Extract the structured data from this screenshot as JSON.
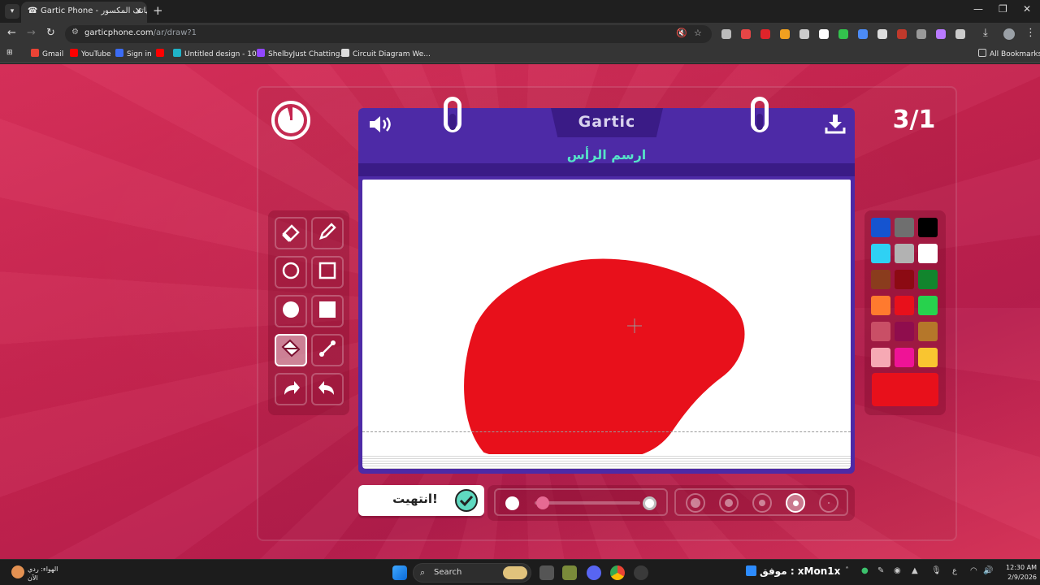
{
  "browser": {
    "tab_title": "Gartic Phone - الهاتف المكسور",
    "tab_favicon": "phone-icon",
    "url_host": "garticphone.com",
    "url_path": "/ar/draw?1",
    "all_bookmarks_label": "All Bookmarks",
    "bookmarks": [
      {
        "label": "Gmail",
        "icon": "gmail-icon",
        "color": "#ea4335"
      },
      {
        "label": "YouTube",
        "icon": "youtube-icon",
        "color": "#ff0000"
      },
      {
        "label": "Sign in",
        "icon": "sign-in-icon",
        "color": "#3b6cf5"
      },
      {
        "label": "",
        "icon": "youtube-icon",
        "color": "#ff0000"
      },
      {
        "label": "Untitled design - 10...",
        "icon": "canva-icon",
        "color": "#1fb3c8"
      },
      {
        "label": "ShelbyJust Chatting...",
        "icon": "twitch-icon",
        "color": "#9147ff"
      },
      {
        "label": "Circuit Diagram We...",
        "icon": "circuit-icon",
        "color": "#dddddd"
      }
    ],
    "extensions": [
      {
        "icon": "ext-square-icon",
        "color": "#bbbbbb"
      },
      {
        "icon": "ext-red-icon",
        "color": "#e64646"
      },
      {
        "icon": "ext-record-icon",
        "color": "#e0242a"
      },
      {
        "icon": "ext-hand-icon",
        "color": "#f0a020"
      },
      {
        "icon": "ext-arrow-icon",
        "color": "#cccccc"
      },
      {
        "icon": "ext-diamond-icon",
        "color": "#ffffff"
      },
      {
        "icon": "ext-battery-icon",
        "color": "#33c24d"
      },
      {
        "icon": "ext-translate-icon",
        "color": "#4c8bf5"
      },
      {
        "icon": "ext-m-icon",
        "color": "#dddddd"
      },
      {
        "icon": "ext-badge-icon",
        "color": "#c0392b"
      },
      {
        "icon": "ext-text-icon",
        "color": "#999999"
      },
      {
        "icon": "ext-music-icon",
        "color": "#b97aff"
      },
      {
        "icon": "puzzle-icon",
        "color": "#cccccc"
      }
    ]
  },
  "game": {
    "round": "3/1",
    "logo": "Gartic",
    "prompt": "ارسم الرأس",
    "done_label": "انتهيت!",
    "colors": {
      "accent_purple": "#4d2aa6",
      "prompt_teal": "#55e3c8",
      "selected_color": "#e8101b"
    },
    "tools": [
      {
        "name": "eraser-tool",
        "icon": "eraser-icon",
        "active": false
      },
      {
        "name": "pencil-tool",
        "icon": "pencil-icon",
        "active": false
      },
      {
        "name": "ellipse-outline-tool",
        "icon": "circle-outline-icon",
        "active": false
      },
      {
        "name": "rectangle-outline-tool",
        "icon": "square-outline-icon",
        "active": false
      },
      {
        "name": "ellipse-filled-tool",
        "icon": "circle-filled-icon",
        "active": false
      },
      {
        "name": "rectangle-filled-tool",
        "icon": "square-filled-icon",
        "active": false
      },
      {
        "name": "fill-bucket-tool",
        "icon": "paint-bucket-icon",
        "active": true
      },
      {
        "name": "line-tool",
        "icon": "line-icon",
        "active": false
      },
      {
        "name": "redo-tool",
        "icon": "redo-icon",
        "active": false
      },
      {
        "name": "undo-tool",
        "icon": "undo-icon",
        "active": false
      }
    ],
    "palette": [
      "#1554d0",
      "#6f6f6f",
      "#000000",
      "#2fd1f4",
      "#b2b2b2",
      "#ffffff",
      "#8a3c1d",
      "#8c0a13",
      "#12852d",
      "#ff7a2e",
      "#e8101b",
      "#27d24d",
      "#c94f66",
      "#8f0d4d",
      "#b5772a",
      "#f6a9b4",
      "#ef1396",
      "#f9c530"
    ],
    "opacity_slider_value": 0.0,
    "brush_sizes": [
      {
        "name": "brush-size-5",
        "selected": false
      },
      {
        "name": "brush-size-4",
        "selected": false
      },
      {
        "name": "brush-size-3",
        "selected": false
      },
      {
        "name": "brush-size-2",
        "selected": true
      },
      {
        "name": "brush-size-1",
        "selected": false
      }
    ]
  },
  "taskbar": {
    "weather_line1": "الهواء: ردي",
    "weather_line2": "الآن",
    "search_label": "Search",
    "twitch_text": "موفق : xMon1x",
    "ime_label": "ع",
    "time": "12:30 AM",
    "date": "2/9/2026"
  }
}
